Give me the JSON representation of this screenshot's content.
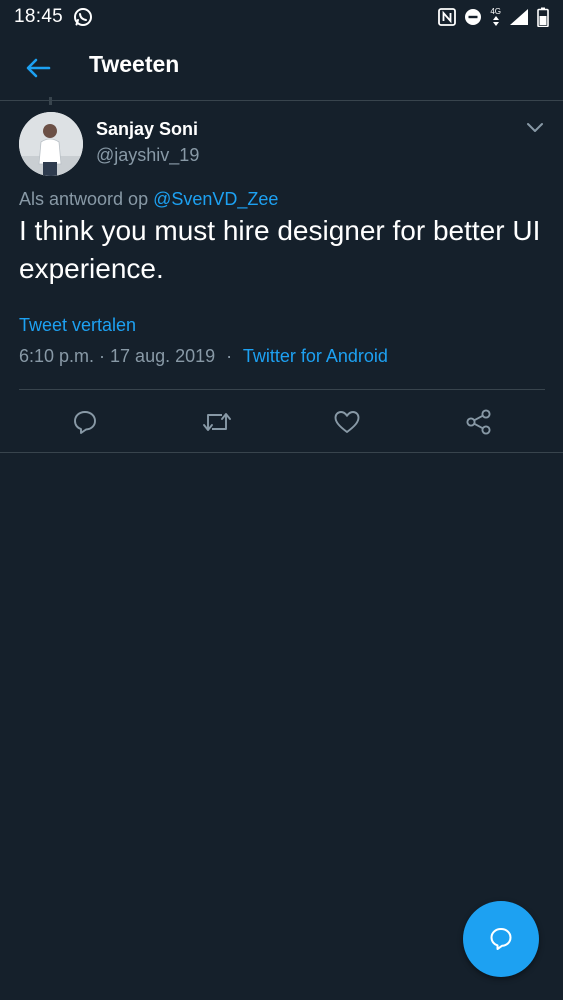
{
  "status_bar": {
    "time": "18:45",
    "network": "4G",
    "icons": [
      "whatsapp-icon",
      "nfc-icon",
      "do-not-disturb-icon",
      "data-arrows-icon",
      "signal-icon",
      "battery-icon"
    ]
  },
  "header": {
    "title": "Tweeten",
    "back_icon": "arrow-left-icon"
  },
  "tweet": {
    "author_name": "Sanjay Soni",
    "author_handle": "@jayshiv_19",
    "reply_prefix": "Als antwoord op",
    "reply_mention": "@SvenVD_Zee",
    "text": "I think you must hire designer for better UI experience.",
    "translate_label": "Tweet vertalen",
    "timestamp": "6:10 p.m. · 17 aug. 2019",
    "separator": "·",
    "source": "Twitter for Android"
  },
  "actions": [
    {
      "name": "reply",
      "icon": "comment-icon"
    },
    {
      "name": "retweet",
      "icon": "retweet-icon"
    },
    {
      "name": "like",
      "icon": "heart-icon"
    },
    {
      "name": "share",
      "icon": "share-icon"
    }
  ],
  "fab": {
    "icon": "compose-reply-icon"
  },
  "colors": {
    "background": "#15202b",
    "divider": "#38444d",
    "accent": "#1da1f2",
    "secondary_text": "#8899a6",
    "primary_text": "#ffffff"
  }
}
